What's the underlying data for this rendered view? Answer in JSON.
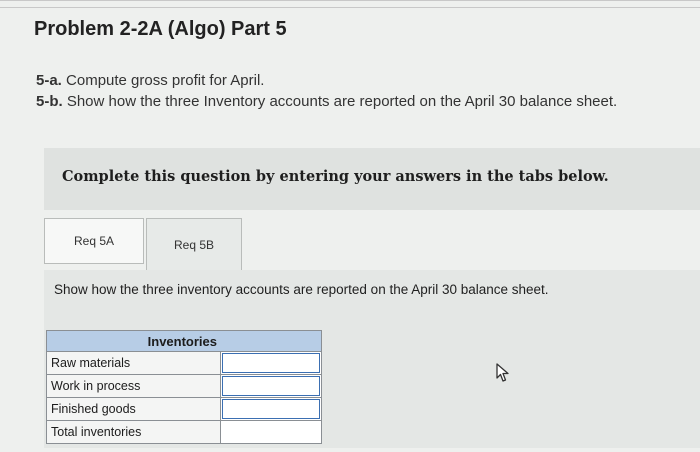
{
  "problem": {
    "title": "Problem 2-2A (Algo) Part 5"
  },
  "instructions": [
    {
      "tag": "5-a.",
      "text": " Compute gross profit for April."
    },
    {
      "tag": "5-b.",
      "text": " Show how the three Inventory accounts are reported on the April 30 balance sheet."
    }
  ],
  "panel": {
    "heading": "Complete this question by entering your answers in the tabs below.",
    "tabs": [
      {
        "label": "Req 5A",
        "active": false
      },
      {
        "label": "Req 5B",
        "active": true
      }
    ],
    "instruction": "Show how the three inventory accounts are reported on the April 30 balance sheet.",
    "table": {
      "header": "Inventories",
      "rows": [
        {
          "label": "Raw materials",
          "value": ""
        },
        {
          "label": "Work in process",
          "value": ""
        },
        {
          "label": "Finished goods",
          "value": ""
        },
        {
          "label": "Total inventories",
          "value": ""
        }
      ]
    }
  },
  "colors": {
    "table_header": "#b7cde6",
    "input_border": "#3b6fb2",
    "panel_bg": "#e2e5e3"
  }
}
